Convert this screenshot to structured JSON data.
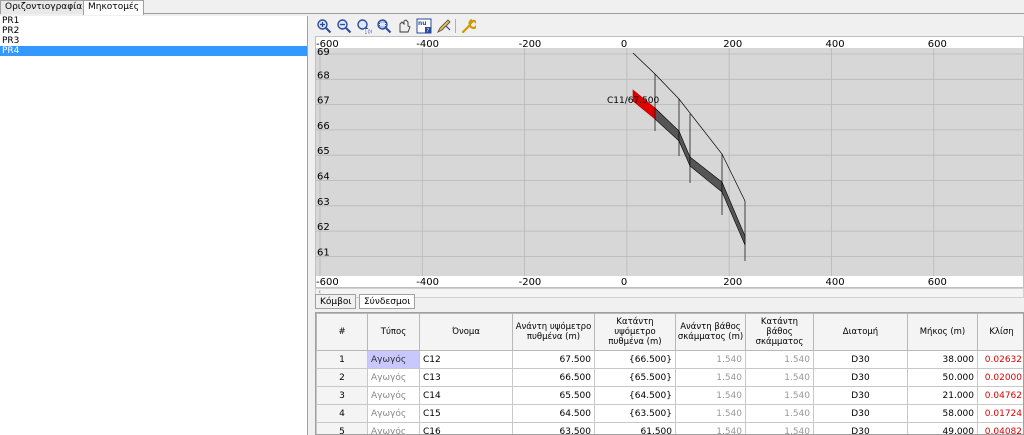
{
  "tabs": [
    "Οριζοντιογραφία",
    "Μηκοτομές"
  ],
  "profiles": [
    "PR1",
    "PR2",
    "PR3",
    "PR4"
  ],
  "selected_profile_index": 3,
  "toolbar_icons": [
    "zoom-in-icon",
    "zoom-out-icon",
    "zoom-100-icon",
    "zoom-window-icon",
    "pan-icon",
    "info-icon",
    "edit-icon",
    "settings-icon"
  ],
  "chart": {
    "x_ticks": [
      "-600",
      "-400",
      "-200",
      "0",
      "200",
      "400",
      "600"
    ],
    "y_ticks": [
      "69",
      "68",
      "67",
      "66",
      "65",
      "64",
      "63",
      "62",
      "61"
    ],
    "annotation": "C11/67.500",
    "colors": {
      "background": "#d7d7d7",
      "grid": "#b8b8b8",
      "pipe_selected": "#e00000",
      "pipe": "#000000"
    }
  },
  "subtabs": [
    "Κόμβοι",
    "Σύνδεσμοι"
  ],
  "table": {
    "headers": [
      "#",
      "Τύπος",
      "Όνομα",
      "Ανάντη υψόμετρο πυθμένα (m)",
      "Κατάντη υψόμετρο πυθμένα (m)",
      "Ανάντη βάθος σκάμματος (m)",
      "Κατάντη βάθος σκάμματος",
      "Διατομή",
      "Μήκος (m)",
      "Κλίση"
    ],
    "rows": [
      [
        "1",
        "Αγωγός",
        "C12",
        "67.500",
        "{66.500}",
        "1.540",
        "1.540",
        "D30",
        "38.000",
        "0.02632"
      ],
      [
        "2",
        "Αγωγός",
        "C13",
        "66.500",
        "{65.500}",
        "1.540",
        "1.540",
        "D30",
        "50.000",
        "0.02000"
      ],
      [
        "3",
        "Αγωγός",
        "C14",
        "65.500",
        "{64.500}",
        "1.540",
        "1.540",
        "D30",
        "21.000",
        "0.04762"
      ],
      [
        "4",
        "Αγωγός",
        "C15",
        "64.500",
        "{63.500}",
        "1.540",
        "1.540",
        "D30",
        "58.000",
        "0.01724"
      ],
      [
        "5",
        "Αγωγός",
        "C16",
        "63.500",
        "61.500",
        "1.540",
        "1.540",
        "D30",
        "49.000",
        "0.04082"
      ]
    ]
  }
}
